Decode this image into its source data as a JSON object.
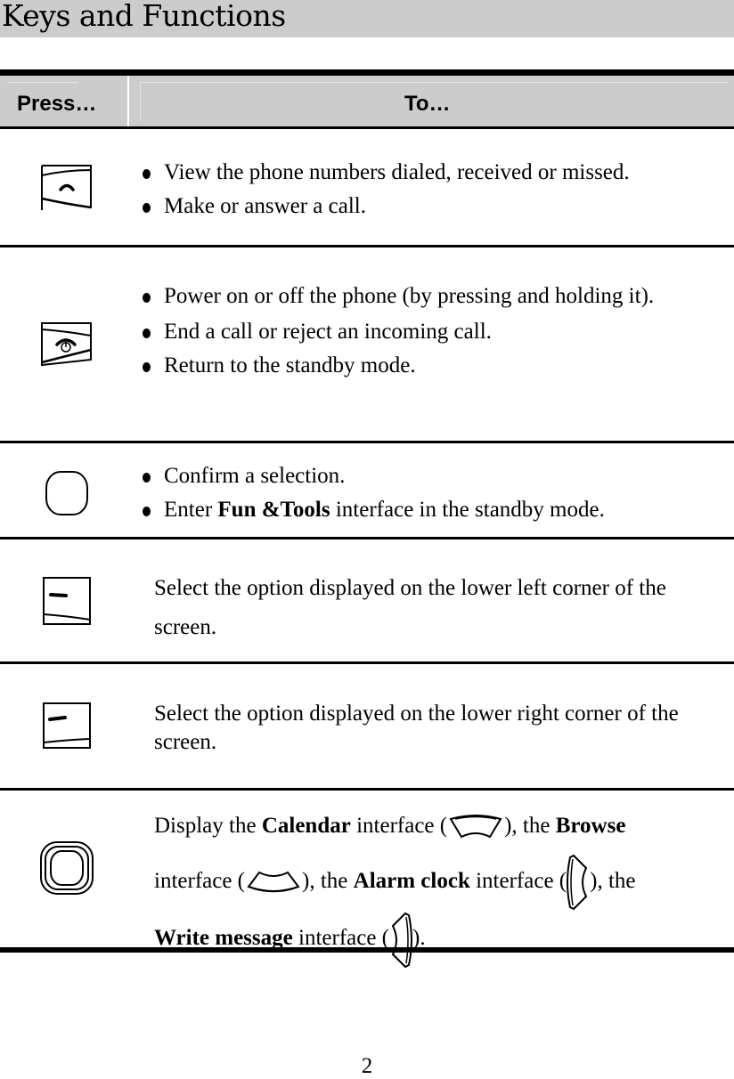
{
  "page": {
    "title": "Keys and Functions",
    "page_number": "2"
  },
  "table": {
    "headers": {
      "press": "Press…",
      "to": "To…"
    },
    "rows": [
      {
        "key_icon": "call-send-key-icon",
        "bullets": [
          "View the phone numbers dialed, received or missed.",
          "Make or answer a call."
        ]
      },
      {
        "key_icon": "end-power-key-icon",
        "bullets": [
          "Power on or off the phone (by pressing and holding it).",
          "End a call or reject an incoming call.",
          "Return to the standby mode."
        ]
      },
      {
        "key_icon": "ok-confirm-key-icon",
        "bullets": [
          "Confirm a selection.",
          {
            "prefix": "Enter ",
            "bold": "Fun &Tools",
            "suffix": " interface in the standby mode."
          }
        ]
      },
      {
        "key_icon": "left-soft-key-icon",
        "text": "Select the option displayed on the lower left corner of the screen."
      },
      {
        "key_icon": "right-soft-key-icon",
        "text": "Select the option displayed on the lower right corner of the screen."
      },
      {
        "key_icon": "navigation-key-icon",
        "parts": {
          "p1": "Display the ",
          "calendar": "Calendar",
          "p2": " interface (",
          "p3": "), the ",
          "browse": "Browse",
          "p4": "interface (",
          "p5": "), the ",
          "alarm": "Alarm clock",
          "p6": " interface (",
          "p7": "), the",
          "write": "Write message",
          "p8": " interface (",
          "p9": ")."
        }
      }
    ]
  }
}
